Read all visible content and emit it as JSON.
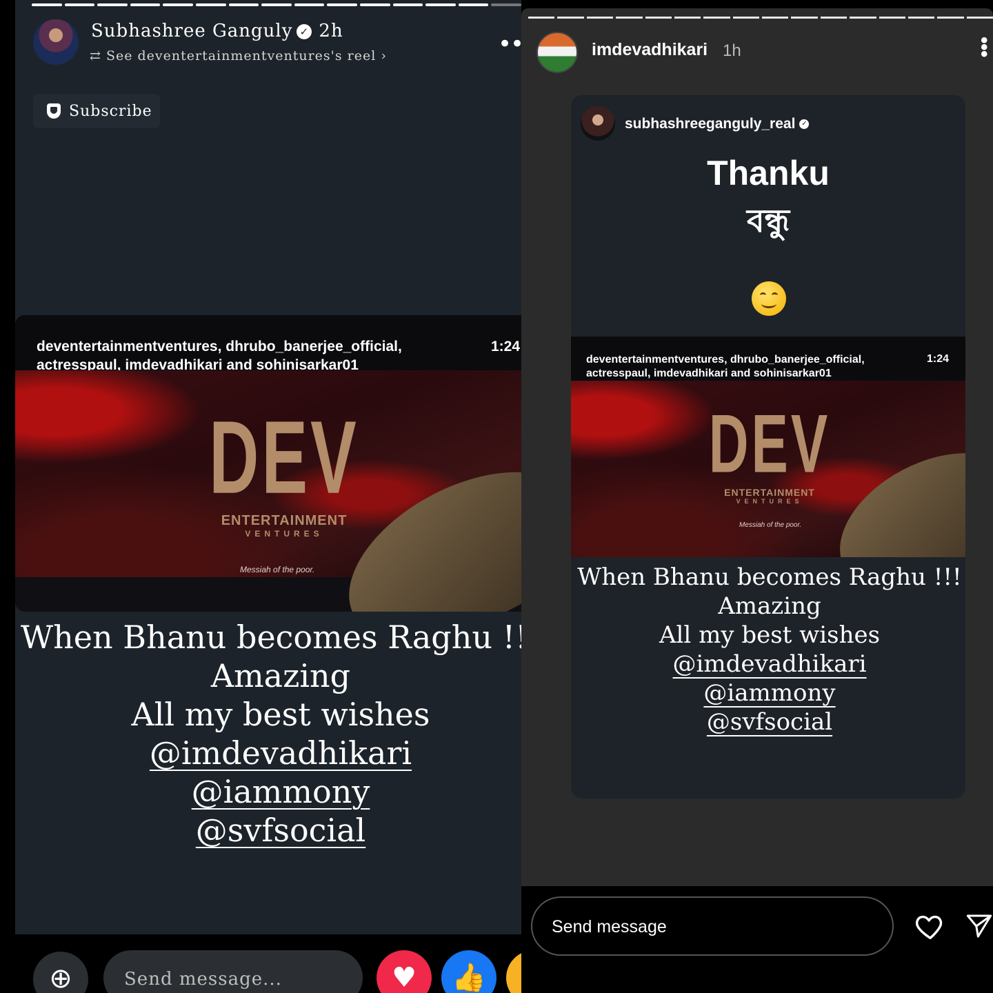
{
  "left_story": {
    "author_name": "Subhashree Ganguly",
    "time": "2h",
    "reshare_text": "See deventertainmentventures's reel",
    "subscribe_label": "Subscribe",
    "reel": {
      "tags_line1": "deventertainmentventures, dhrubo_banerjee_official,",
      "tags_line2": "actresspaul, imdevadhikari and sohinisarkar01",
      "duration": "1:24",
      "logo_text": "DEV",
      "logo_sub1": "ENTERTAINMENT",
      "logo_sub2": "VENTURES",
      "tagline": "Messiah of the poor."
    },
    "caption": {
      "line1": "When Bhanu becomes Raghu !!!",
      "line2": "Amazing",
      "line3": "All my best wishes",
      "mention1": "@imdevadhikari",
      "mention2": "@iammony",
      "mention3": "@svfsocial"
    },
    "message_placeholder": "Send message..."
  },
  "right_story": {
    "username": "imdevadhikari",
    "time": "1h",
    "shared_from": "subhashreeganguly_real",
    "headline": "Thanku",
    "headline_bengali": "বন্ধু",
    "reel": {
      "tags_line1": "deventertainmentventures, dhrubo_banerjee_official,",
      "tags_line2": "actresspaul, imdevadhikari and sohinisarkar01",
      "duration": "1:24",
      "logo_text": "DEV",
      "logo_sub1": "ENTERTAINMENT",
      "logo_sub2": "VENTURES",
      "tagline": "Messiah of the poor."
    },
    "caption": {
      "line1": "When Bhanu becomes Raghu !!!",
      "line2": "Amazing",
      "line3": "All my best wishes",
      "mention1": "@imdevadhikari",
      "mention2": "@iammony",
      "mention3": "@svfsocial"
    },
    "message_placeholder": "Send message"
  },
  "colors": {
    "fb_story_bg": "#1d232a",
    "ig_story_bg": "#2b2b2b",
    "ig_card_bg": "#1e232a",
    "love_reaction": "#f02849",
    "like_reaction": "#1877f2",
    "haha_reaction": "#f7b125"
  },
  "icons": {
    "verified": "verified-badge-icon",
    "repost": "repost-icon",
    "chevron": "chevron-right-icon",
    "more": "more-dots-icon",
    "subscribe": "shield-icon",
    "add": "add-circle-icon",
    "love": "heart-reaction-icon",
    "like": "thumbs-up-reaction-icon",
    "haha": "haha-reaction-icon",
    "ig_like": "heart-icon",
    "ig_send": "send-icon"
  }
}
